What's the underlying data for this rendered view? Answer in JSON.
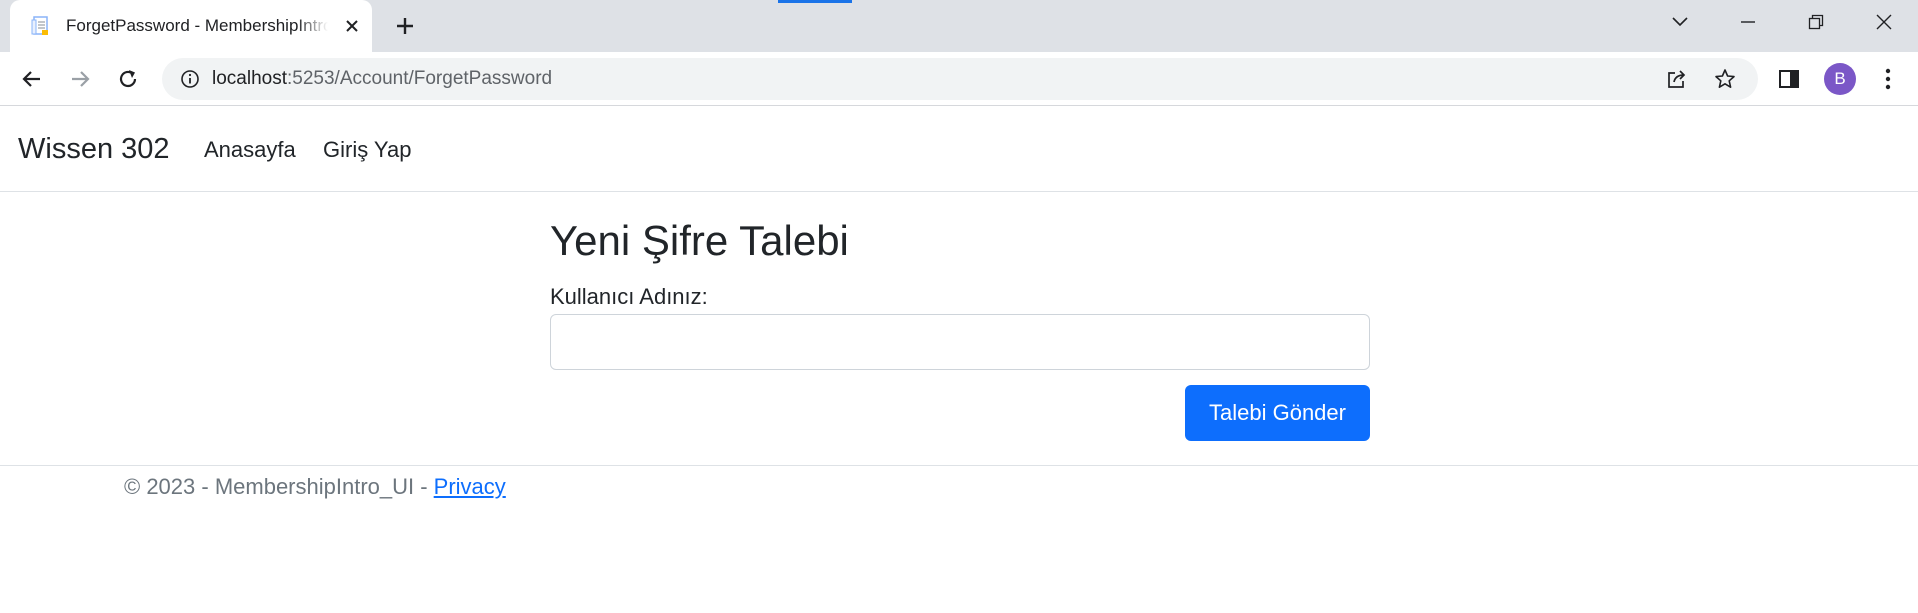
{
  "browser": {
    "tab_title": "ForgetPassword - MembershipIntro_UI",
    "url_host": "localhost",
    "url_path": ":5253/Account/ForgetPassword",
    "profile_initial": "B",
    "accent_color": "#1a73e8",
    "avatar_color": "#7b57c7",
    "icons": [
      "page-favicon",
      "close-icon",
      "plus-icon",
      "chevron-down-icon",
      "minimize-icon",
      "restore-icon",
      "window-close-icon",
      "back-arrow-icon",
      "forward-arrow-icon",
      "reload-icon",
      "info-icon",
      "share-icon",
      "star-icon",
      "side-panel-icon",
      "more-vert-icon"
    ]
  },
  "navbar": {
    "brand": "Wissen 302",
    "links": [
      "Anasayfa",
      "Giriş Yap"
    ]
  },
  "main": {
    "title": "Yeni Şifre Talebi",
    "username_label": "Kullanıcı Adınız:",
    "username_value": "",
    "submit_label": "Talebi Gönder",
    "button_color": "#0d6efd"
  },
  "footer": {
    "text": "© 2023 - MembershipIntro_UI - ",
    "link": "Privacy"
  }
}
